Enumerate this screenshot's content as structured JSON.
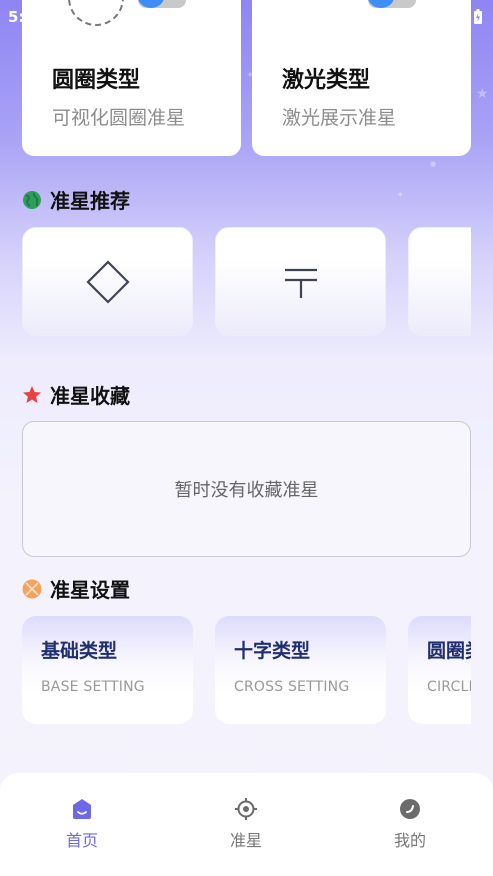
{
  "status_bar": {
    "time_partial": "5:"
  },
  "type_cards": [
    {
      "title": "圆圈类型",
      "subtitle": "可视化圆圈准星"
    },
    {
      "title": "激光类型",
      "subtitle": "激光展示准星"
    }
  ],
  "sections": {
    "recommend": "准星推荐",
    "favorites": "准星收藏",
    "settings": "准星设置"
  },
  "favorites_empty": "暂时没有收藏准星",
  "recommend_items": [
    {
      "icon": "diamond-crosshair-icon"
    },
    {
      "icon": "t-crosshair-icon"
    },
    {
      "icon": "crosshair-icon"
    }
  ],
  "setting_cards": [
    {
      "title": "基础类型",
      "subtitle": "BASE SETTING"
    },
    {
      "title": "十字类型",
      "subtitle": "CROSS SETTING"
    },
    {
      "title": "圆圈类型",
      "subtitle": "CIRCLE SETTING"
    }
  ],
  "bottom_nav": [
    {
      "label": "首页",
      "icon": "home-icon",
      "active": true
    },
    {
      "label": "准星",
      "icon": "crosshair-icon",
      "active": false
    },
    {
      "label": "我的",
      "icon": "profile-icon",
      "active": false
    }
  ],
  "colors": {
    "accent": "#6f68e6",
    "toggle_on": "#3f8ef6",
    "setting_title": "#1f2e6e"
  }
}
